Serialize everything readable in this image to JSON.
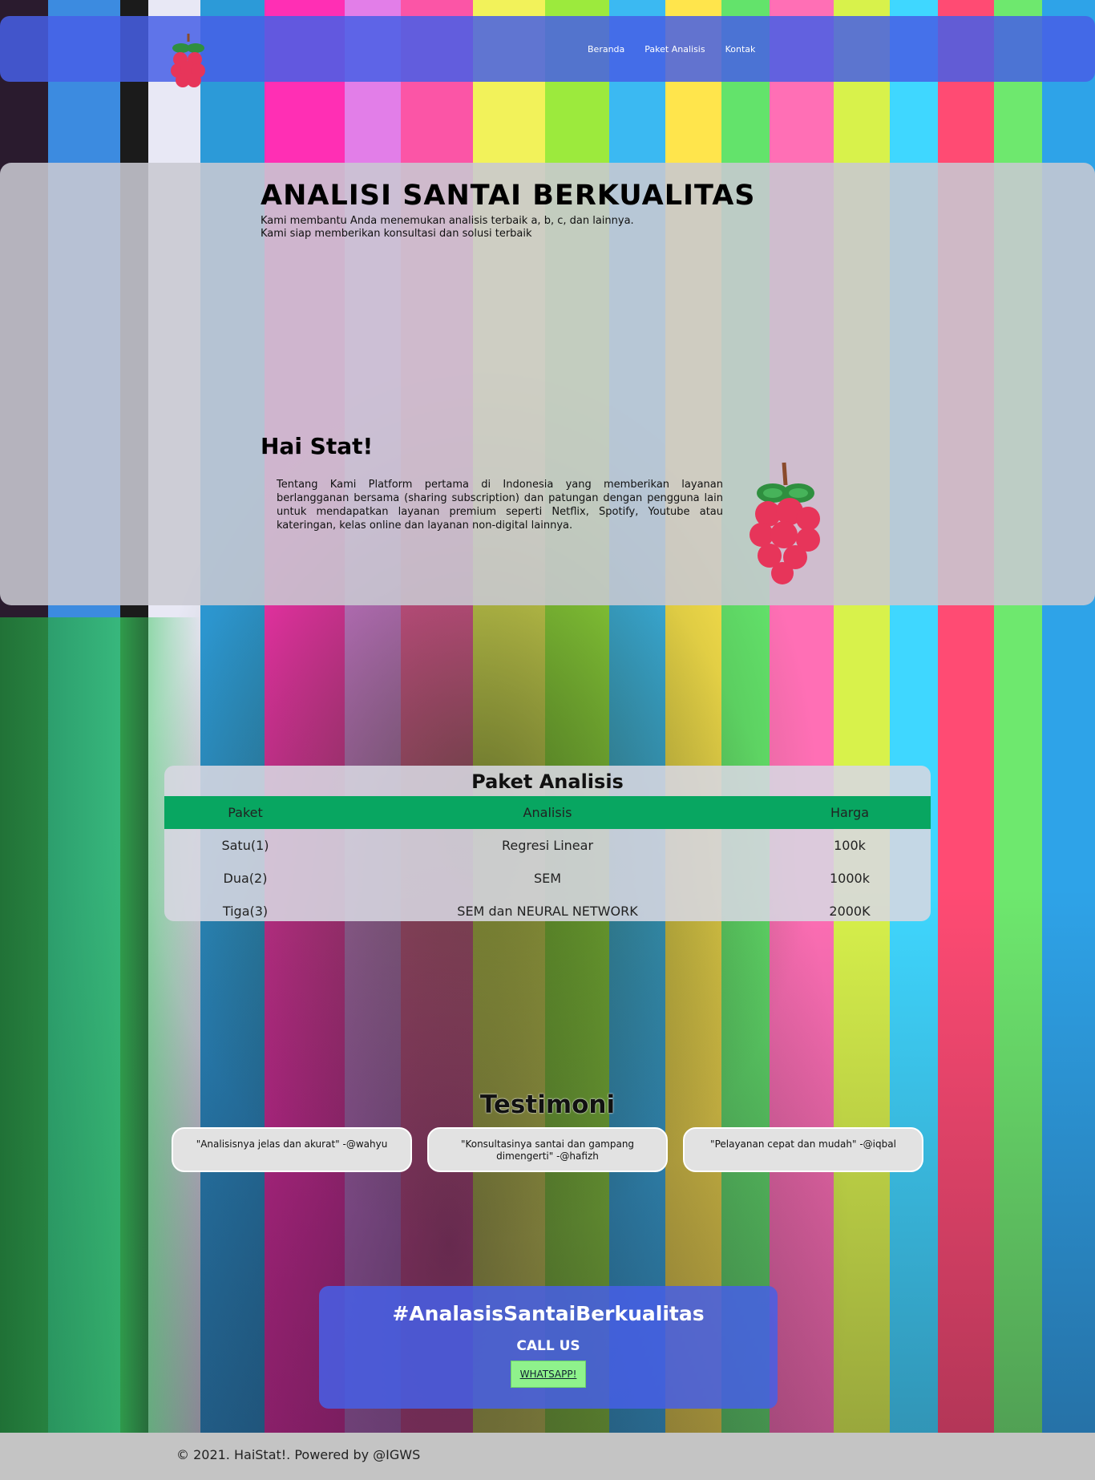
{
  "nav": {
    "logo_icon": "raspberry-icon",
    "items": [
      "Beranda",
      "Paket Analisis",
      "Kontak"
    ]
  },
  "hero": {
    "title": "ANALISI SANTAI BERKUALITAS",
    "line1": "Kami membantu Anda menemukan analisis terbaik a, b, c, dan lainnya.",
    "line2": "Kami siap memberikan konsultasi dan solusi terbaik"
  },
  "about": {
    "title": "Hai Stat!",
    "text": "Tentang Kami Platform pertama di Indonesia yang memberikan layanan berlangganan bersama (sharing subscription) dan patungan dengan pengguna lain untuk mendapatkan layanan premium seperti Netflix, Spotify, Youtube atau kateringan, kelas online dan layanan non-digital lainnya.",
    "image_icon": "raspberry-icon"
  },
  "packages": {
    "title": "Paket Analisis",
    "headers": [
      "Paket",
      "Analisis",
      "Harga"
    ],
    "rows": [
      [
        "Satu(1)",
        "Regresi Linear",
        "100k"
      ],
      [
        "Dua(2)",
        "SEM",
        "1000k"
      ],
      [
        "Tiga(3)",
        "SEM dan NEURAL NETWORK",
        "2000K"
      ]
    ],
    "header_color": "#08a661"
  },
  "testimonials": {
    "title": "Testimoni",
    "items": [
      "\"Analisisnya jelas dan akurat\" -@wahyu",
      "\"Konsultasinya santai dan gampang dimengerti\" -@hafizh",
      "\"Pelayanan cepat dan mudah\" -@iqbal"
    ]
  },
  "cta": {
    "hashtag": "#AnalasisSantaiBerkualitas",
    "call": "CALL US",
    "button": "WHATSAPP!"
  },
  "footer": {
    "text": "© 2021. HaiStat!. Powered by @IGWS"
  },
  "colors": {
    "nav_bg": "#465fe6",
    "table_header": "#08a661",
    "button": "#8ff28c"
  }
}
